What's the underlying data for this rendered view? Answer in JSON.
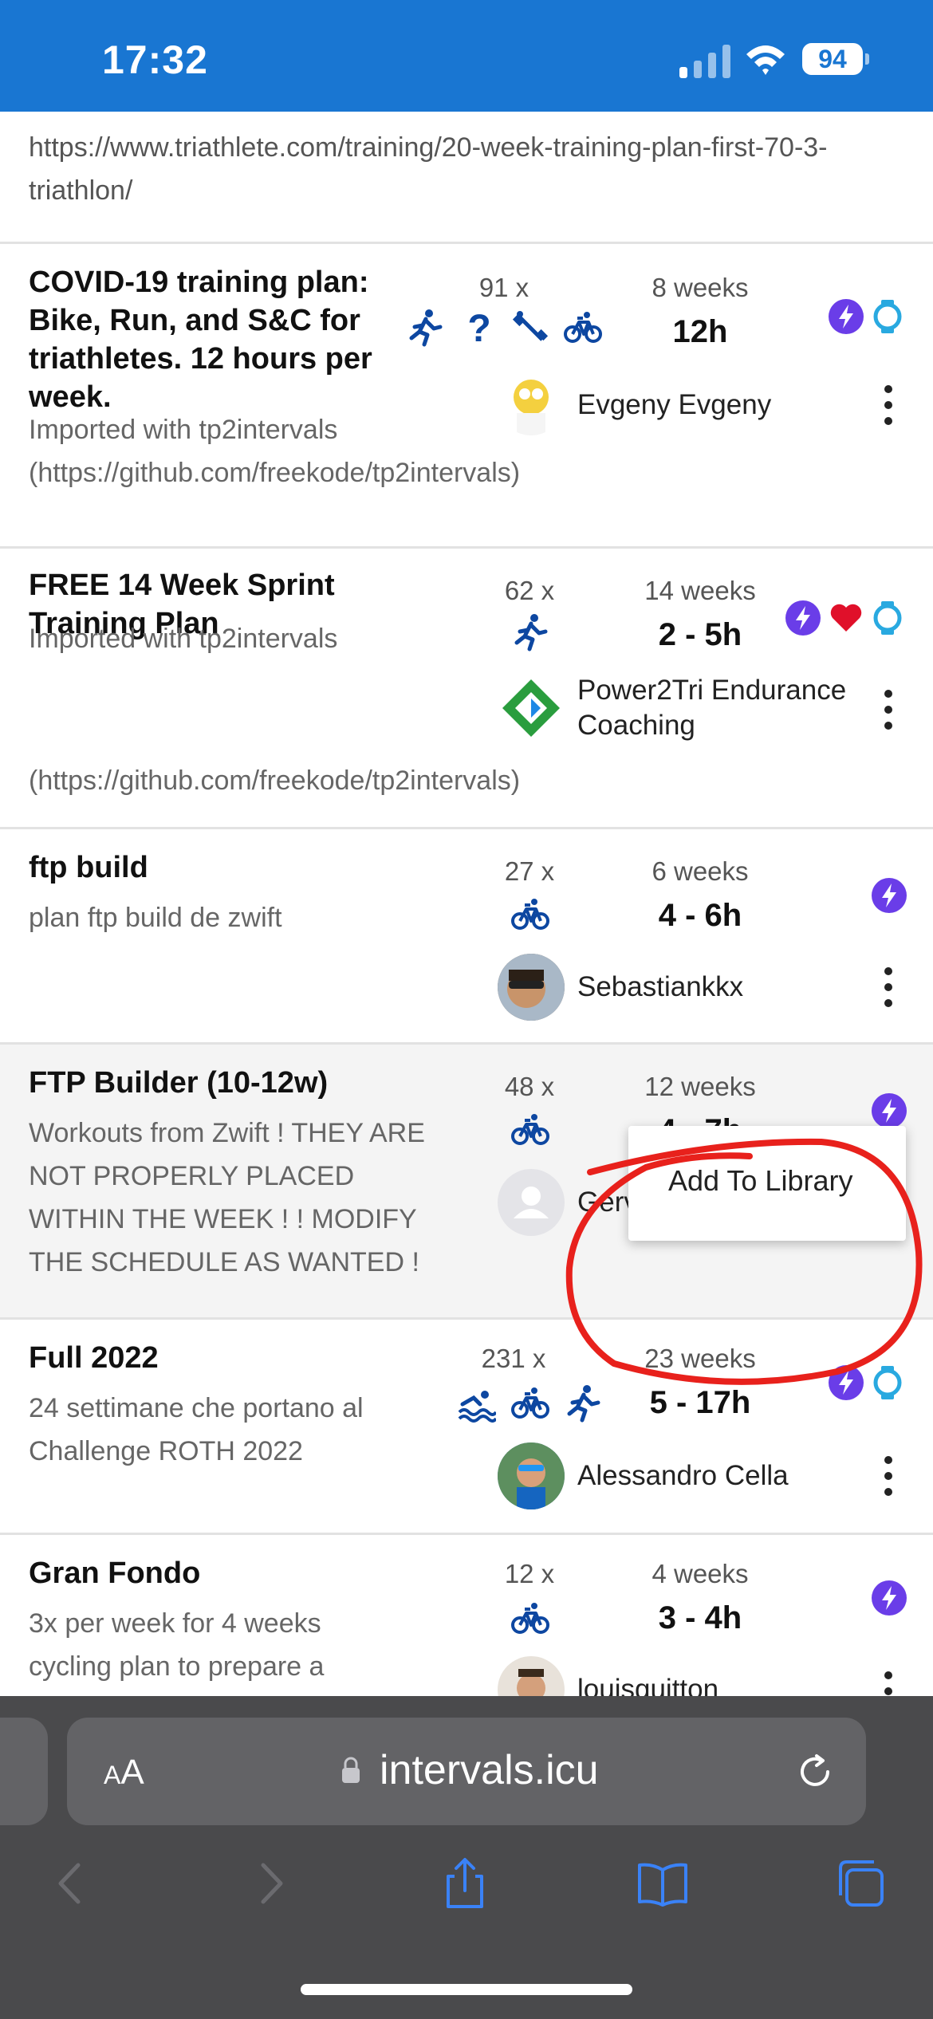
{
  "status_bar": {
    "time": "17:32",
    "battery": "94"
  },
  "url_row": {
    "text": "https://www.triathlete.com/training/20-week-training-plan-first-70-3-triathlon/"
  },
  "plans": [
    {
      "title": "COVID-19 training plan: Bike, Run, and S&C for triathletes. 12 hours per week.",
      "description": "Imported with tp2intervals (https://github.com/freekode/tp2intervals)",
      "count": "91 x",
      "weeks": "8 weeks",
      "hours": "12h",
      "author": "Evgeny Evgeny",
      "sports": [
        "run-icon",
        "question-icon",
        "strength-icon",
        "bike-icon"
      ],
      "badges": [
        "bolt-icon",
        "watch-icon"
      ]
    },
    {
      "title": "FREE 14 Week Sprint Training Plan",
      "description_line1": "Imported with tp2intervals",
      "description_line2": "(https://github.com/freekode/tp2intervals)",
      "count": "62 x",
      "weeks": "14 weeks",
      "hours": "2 - 5h",
      "author": "Power2Tri Endurance Coaching",
      "sports": [
        "run-icon"
      ],
      "badges": [
        "bolt-icon",
        "heart-icon",
        "watch-icon"
      ]
    },
    {
      "title": "ftp build",
      "description": "plan ftp build de zwift",
      "count": "27 x",
      "weeks": "6 weeks",
      "hours": "4 - 6h",
      "author": "Sebastiankkx",
      "sports": [
        "bike-icon"
      ],
      "badges": [
        "bolt-icon"
      ]
    },
    {
      "title": "FTP Builder (10-12w)",
      "description": "Workouts from Zwift ! THEY ARE NOT PROPERLY PLACED WITHIN THE WEEK ! ! MODIFY THE SCHEDULE AS WANTED !",
      "count": "48 x",
      "weeks": "12 weeks",
      "hours": "4 - 7h",
      "author": "Gervel",
      "sports": [
        "bike-icon"
      ],
      "badges": [
        "bolt-icon"
      ]
    },
    {
      "title": "Full 2022",
      "description": "24 settimane che portano al Challenge ROTH 2022",
      "count": "231 x",
      "weeks": "23 weeks",
      "hours": "5 - 17h",
      "author": "Alessandro Cella",
      "sports": [
        "swim-icon",
        "bike-icon",
        "run-icon"
      ],
      "badges": [
        "bolt-icon",
        "watch-icon"
      ]
    },
    {
      "title": "Gran Fondo",
      "description": "3x per week for 4 weeks cycling plan to prepare a",
      "count": "12 x",
      "weeks": "4 weeks",
      "hours": "3 - 4h",
      "author": "louisguitton",
      "sports": [
        "bike-icon"
      ],
      "badges": [
        "bolt-icon"
      ]
    }
  ],
  "context_menu": {
    "item": "Add To Library"
  },
  "safari": {
    "text_size": "AA",
    "host": "intervals.icu"
  },
  "colors": {
    "status_bar": "#1976d2",
    "accent_blue": "#0d47a1",
    "bolt_purple": "#6a3de8",
    "watch_cyan": "#29a9e0",
    "heart_red": "#e0102a",
    "annotation_red": "#e8211c",
    "safari_bg": "#4a4a4c",
    "safari_blue": "#3a82f7"
  }
}
